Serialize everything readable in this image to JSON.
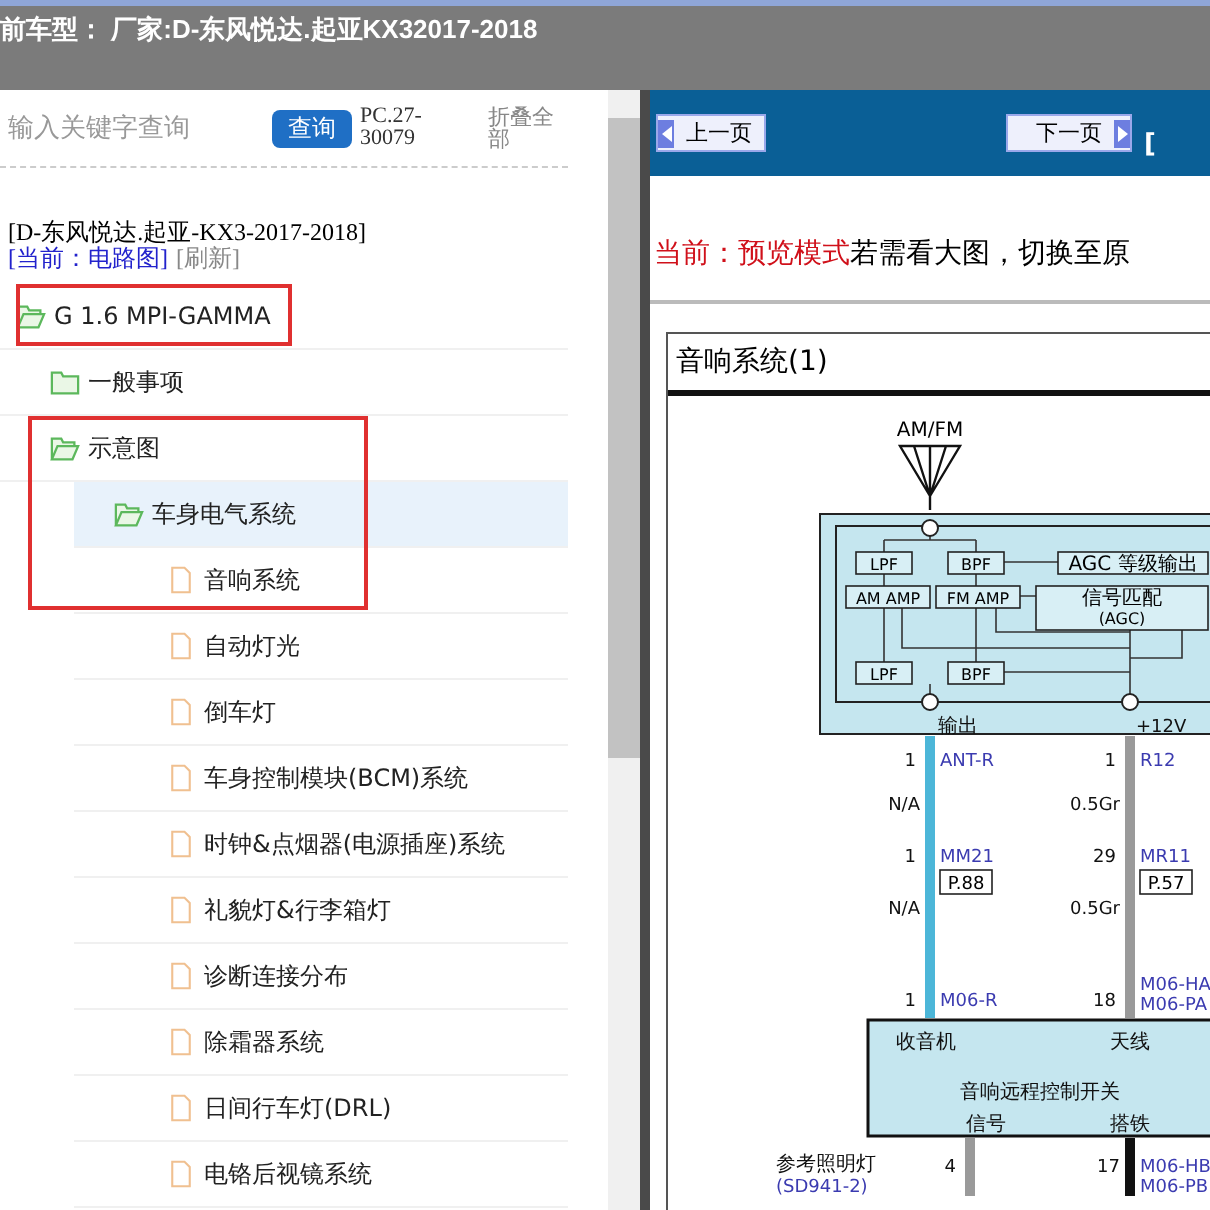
{
  "header": {
    "title": "前车型： 厂家:D-东风悦达.起亚KX32017-2018"
  },
  "left": {
    "search": {
      "placeholder": "输入关键字查询",
      "button": "查询",
      "code": "PC.27-30079",
      "collapse": "折叠全部"
    },
    "model": "[D-东风悦达.起亚-KX3-2017-2018]",
    "current": "[当前：电路图]",
    "refresh": "[刷新]",
    "tree": [
      {
        "label": "G 1.6 MPI-GAMMA",
        "kind": "folder",
        "expanded": true,
        "selected": false,
        "framed": true,
        "children": [
          {
            "label": "一般事项",
            "kind": "folder",
            "expanded": false,
            "selected": false,
            "framed": false
          },
          {
            "label": "示意图",
            "kind": "folder",
            "expanded": true,
            "selected": false,
            "framed": true,
            "children": [
              {
                "label": "车身电气系统",
                "kind": "folder",
                "expanded": true,
                "selected": true,
                "framed": true,
                "children": [
                  {
                    "label": "音响系统",
                    "kind": "file",
                    "selected": false,
                    "framed": true
                  },
                  {
                    "label": "自动灯光",
                    "kind": "file",
                    "selected": false,
                    "framed": false
                  },
                  {
                    "label": "倒车灯",
                    "kind": "file",
                    "selected": false,
                    "framed": false
                  },
                  {
                    "label": "车身控制模块(BCM)系统",
                    "kind": "file",
                    "selected": false,
                    "framed": false
                  },
                  {
                    "label": "时钟&点烟器(电源插座)系统",
                    "kind": "file",
                    "selected": false,
                    "framed": false
                  },
                  {
                    "label": "礼貌灯&行李箱灯",
                    "kind": "file",
                    "selected": false,
                    "framed": false
                  },
                  {
                    "label": "诊断连接分布",
                    "kind": "file",
                    "selected": false,
                    "framed": false
                  },
                  {
                    "label": "除霜器系统",
                    "kind": "file",
                    "selected": false,
                    "framed": false
                  },
                  {
                    "label": "日间行车灯(DRL)",
                    "kind": "file",
                    "selected": false,
                    "framed": false
                  },
                  {
                    "label": "电铬后视镜系统",
                    "kind": "file",
                    "selected": false,
                    "framed": false
                  }
                ]
              }
            ]
          }
        ]
      }
    ]
  },
  "right": {
    "prev": "上一页",
    "next": "下一页",
    "toolbar_cut": "[",
    "mode_label": "当前：预览模式",
    "mode_hint": "若需看大图，切换至原",
    "diagram": {
      "title": "音响系统(1)",
      "antenna": "AM/FM",
      "blocks": [
        {
          "lines": [
            "LPF"
          ]
        },
        {
          "lines": [
            "BPF"
          ]
        },
        {
          "lines": [
            "AGC 等级输出"
          ]
        },
        {
          "lines": [
            "AM AMP"
          ]
        },
        {
          "lines": [
            "FM AMP"
          ]
        },
        {
          "lines": [
            "信号匹配",
            "(AGC)"
          ]
        },
        {
          "lines": [
            "LPF"
          ]
        },
        {
          "lines": [
            "BPF"
          ]
        }
      ],
      "refs": [
        "P.88",
        "P.57"
      ],
      "labels": [
        {
          "text": "输出",
          "kind": "text"
        },
        {
          "text": "+12V",
          "kind": "text"
        },
        {
          "text": "1",
          "kind": "text"
        },
        {
          "text": "ANT-R",
          "kind": "connector"
        },
        {
          "text": "1",
          "kind": "text"
        },
        {
          "text": "R12",
          "kind": "connector"
        },
        {
          "text": "N/A",
          "kind": "text"
        },
        {
          "text": "0.5Gr",
          "kind": "text"
        },
        {
          "text": "1",
          "kind": "text"
        },
        {
          "text": "MM21",
          "kind": "connector"
        },
        {
          "text": "29",
          "kind": "text"
        },
        {
          "text": "MR11",
          "kind": "connector"
        },
        {
          "text": "N/A",
          "kind": "text"
        },
        {
          "text": "0.5Gr",
          "kind": "text"
        },
        {
          "text": "1",
          "kind": "text"
        },
        {
          "text": "M06-R",
          "kind": "connector"
        },
        {
          "text": "18",
          "kind": "text"
        },
        {
          "text": "M06-HA",
          "kind": "connector"
        },
        {
          "text": "M06-PA",
          "kind": "connector"
        },
        {
          "text": "收音机",
          "kind": "text"
        },
        {
          "text": "天线",
          "kind": "text"
        },
        {
          "text": "音响远程控制开关",
          "kind": "text"
        },
        {
          "text": "信号",
          "kind": "text"
        },
        {
          "text": "搭铁",
          "kind": "text"
        },
        {
          "text": "参考照明灯",
          "kind": "text"
        },
        {
          "text": "(SD941-2)",
          "kind": "connector"
        },
        {
          "text": "4",
          "kind": "text"
        },
        {
          "text": "17",
          "kind": "text"
        },
        {
          "text": "M06-HB",
          "kind": "connector"
        },
        {
          "text": "M06-PB",
          "kind": "connector"
        }
      ]
    }
  }
}
